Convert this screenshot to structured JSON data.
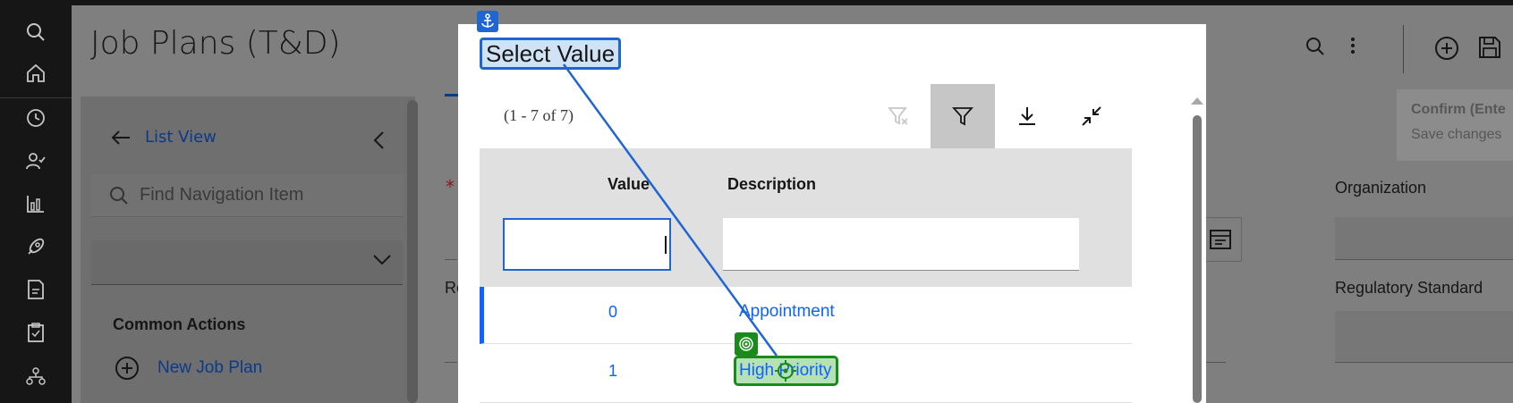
{
  "page": {
    "title": "Job Plans (T&D)"
  },
  "sidebar": {
    "list_view": "List View",
    "find_placeholder": "Find Navigation Item",
    "common_actions": "Common Actions",
    "new_job_plan": "New Job Plan"
  },
  "form": {
    "required_marker": "*",
    "partial_label": "Re",
    "organization_label": "Organization",
    "regulatory_label": "Regulatory Standard"
  },
  "confirm": {
    "title": "Confirm (Ente",
    "subtitle": "Save changes"
  },
  "modal": {
    "title": "Select Value",
    "count": "(1 - 7 of 7)",
    "columns": {
      "value": "Value",
      "description": "Description"
    },
    "rows": [
      {
        "value": "0",
        "description": "Appointment"
      },
      {
        "value": "1",
        "description": "High Priority"
      }
    ]
  },
  "colors": {
    "accent": "#0f62fe",
    "rail": "#161616",
    "overlay_annotation": "#1f66d4",
    "target_annotation": "#1a8a1a"
  }
}
